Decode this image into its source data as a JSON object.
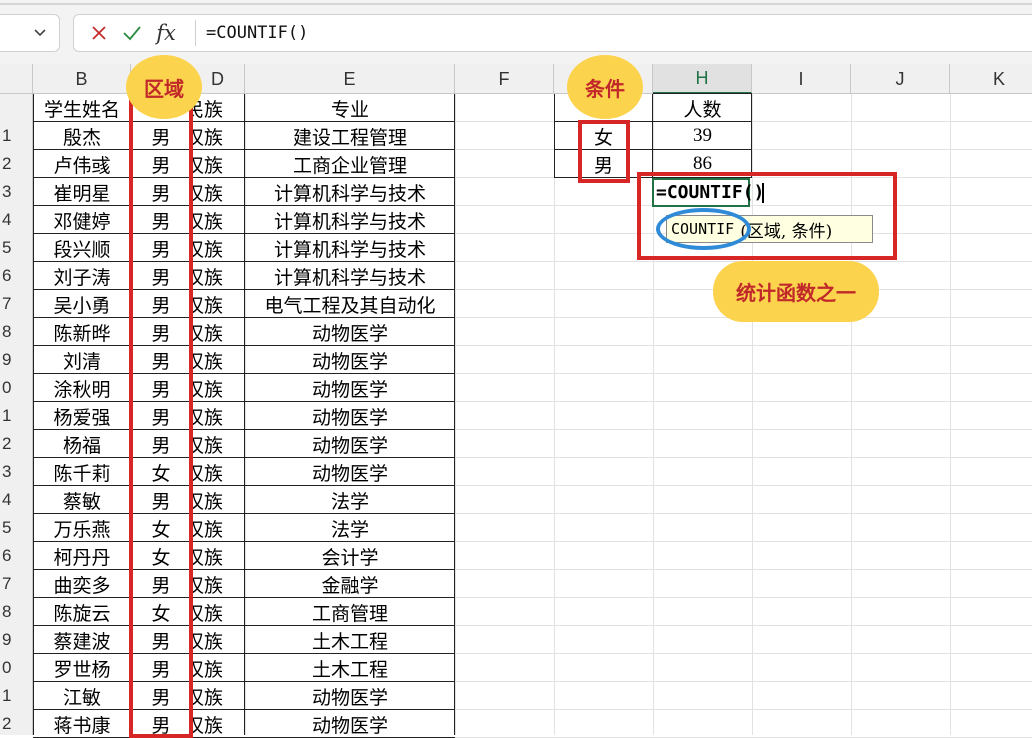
{
  "formula_bar": {
    "cancel_icon": "close-icon",
    "enter_icon": "check-icon",
    "fx_label": "fx",
    "formula": "=COUNTIF()"
  },
  "columns": [
    {
      "id": "col-a",
      "label": ""
    },
    {
      "id": "col-b",
      "label": "B"
    },
    {
      "id": "col-c",
      "label": "区域"
    },
    {
      "id": "col-d",
      "label": "D"
    },
    {
      "id": "col-e",
      "label": "E"
    },
    {
      "id": "col-f",
      "label": "F"
    },
    {
      "id": "col-g",
      "label": "条件"
    },
    {
      "id": "col-h",
      "label": "H"
    },
    {
      "id": "col-i",
      "label": "I"
    },
    {
      "id": "col-j",
      "label": "J"
    },
    {
      "id": "col-k",
      "label": "K"
    }
  ],
  "row_headers": [
    "",
    "1",
    "2",
    "3",
    "4",
    "5",
    "6",
    "7",
    "8",
    "9",
    "0",
    "1",
    "2",
    "3",
    "4",
    "5",
    "6",
    "7",
    "8",
    "9",
    "0",
    "1",
    "2"
  ],
  "table_header": {
    "name": "学生姓名",
    "ethnic": "民族",
    "major": "专业"
  },
  "students": [
    {
      "name": "殷杰",
      "gender": "男",
      "ethnic": "汉族",
      "major": "建设工程管理"
    },
    {
      "name": "卢伟彧",
      "gender": "男",
      "ethnic": "汉族",
      "major": "工商企业管理"
    },
    {
      "name": "崔明星",
      "gender": "男",
      "ethnic": "汉族",
      "major": "计算机科学与技术"
    },
    {
      "name": "邓健婷",
      "gender": "男",
      "ethnic": "汉族",
      "major": "计算机科学与技术"
    },
    {
      "name": "段兴顺",
      "gender": "男",
      "ethnic": "汉族",
      "major": "计算机科学与技术"
    },
    {
      "name": "刘子涛",
      "gender": "男",
      "ethnic": "汉族",
      "major": "计算机科学与技术"
    },
    {
      "name": "吴小勇",
      "gender": "男",
      "ethnic": "汉族",
      "major": "电气工程及其自动化"
    },
    {
      "name": "陈新晔",
      "gender": "男",
      "ethnic": "汉族",
      "major": "动物医学"
    },
    {
      "name": "刘清",
      "gender": "男",
      "ethnic": "汉族",
      "major": "动物医学"
    },
    {
      "name": "涂秋明",
      "gender": "男",
      "ethnic": "汉族",
      "major": "动物医学"
    },
    {
      "name": "杨爱强",
      "gender": "男",
      "ethnic": "汉族",
      "major": "动物医学"
    },
    {
      "name": "杨福",
      "gender": "男",
      "ethnic": "汉族",
      "major": "动物医学"
    },
    {
      "name": "陈千莉",
      "gender": "女",
      "ethnic": "汉族",
      "major": "动物医学"
    },
    {
      "name": "蔡敏",
      "gender": "男",
      "ethnic": "汉族",
      "major": "法学"
    },
    {
      "name": "万乐燕",
      "gender": "女",
      "ethnic": "汉族",
      "major": "法学"
    },
    {
      "name": "柯丹丹",
      "gender": "女",
      "ethnic": "汉族",
      "major": "会计学"
    },
    {
      "name": "曲奕多",
      "gender": "男",
      "ethnic": "汉族",
      "major": "金融学"
    },
    {
      "name": "陈旋云",
      "gender": "女",
      "ethnic": "汉族",
      "major": "工商管理"
    },
    {
      "name": "蔡建波",
      "gender": "男",
      "ethnic": "汉族",
      "major": "土木工程"
    },
    {
      "name": "罗世杨",
      "gender": "男",
      "ethnic": "汉族",
      "major": "土木工程"
    },
    {
      "name": "江敏",
      "gender": "男",
      "ethnic": "汉族",
      "major": "动物医学"
    },
    {
      "name": "蒋书康",
      "gender": "男",
      "ethnic": "汉族",
      "major": "动物医学"
    }
  ],
  "summary": {
    "count_header": "人数",
    "rows": [
      {
        "gender": "女",
        "count": "39"
      },
      {
        "gender": "男",
        "count": "86"
      }
    ]
  },
  "editing": {
    "text": "=COUNTIF(",
    "close_paren": ")",
    "tooltip_function": "COUNTIF",
    "tooltip_args": "(区域, 条件)"
  },
  "annotations": {
    "region_bubble": "区域",
    "criteria_bubble": "条件",
    "note_bubble": "统计函数之一"
  },
  "colors": {
    "accent_green": "#217346",
    "annotation_red": "#d62626",
    "bubble_yellow": "#fcd34d",
    "oval_blue": "#2f8bd8"
  }
}
